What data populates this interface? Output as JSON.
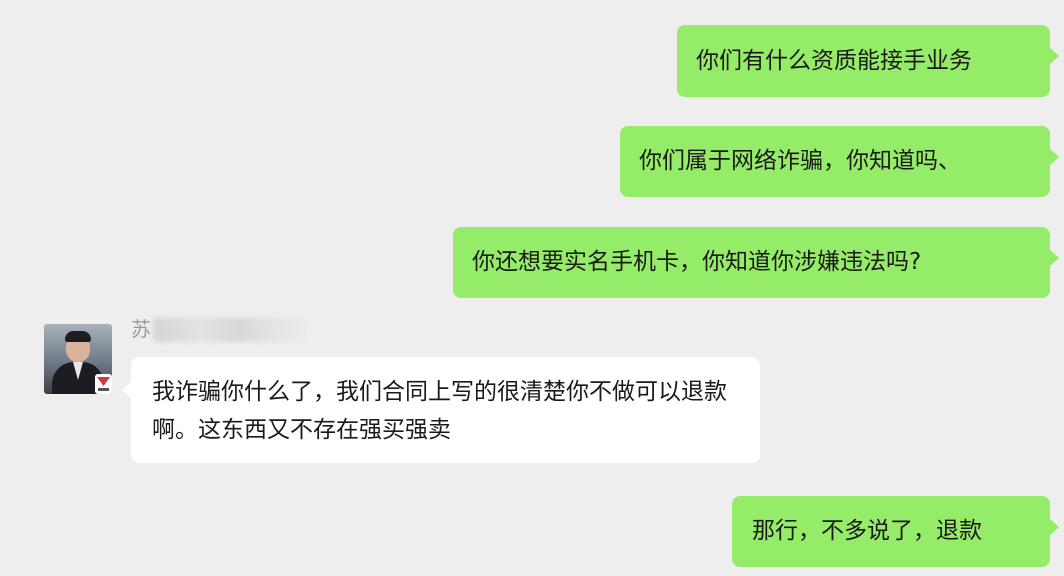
{
  "chat": {
    "messages": [
      {
        "side": "right",
        "text": "你们有什么资质能接手业务"
      },
      {
        "side": "right",
        "text": "你们属于网络诈骗，你知道吗、"
      },
      {
        "side": "right",
        "text": "你还想要实名手机卡，你知道你涉嫌违法吗?"
      },
      {
        "side": "left",
        "text": "我诈骗你什么了，我们合同上写的很清楚你不做可以退款啊。这东西又不存在强买强卖"
      },
      {
        "side": "right",
        "text": "那行，不多说了，退款"
      }
    ],
    "sender": {
      "name_visible": "苏"
    }
  },
  "colors": {
    "background": "#eeeeee",
    "outgoing_bubble": "#95ec69",
    "incoming_bubble": "#ffffff"
  }
}
